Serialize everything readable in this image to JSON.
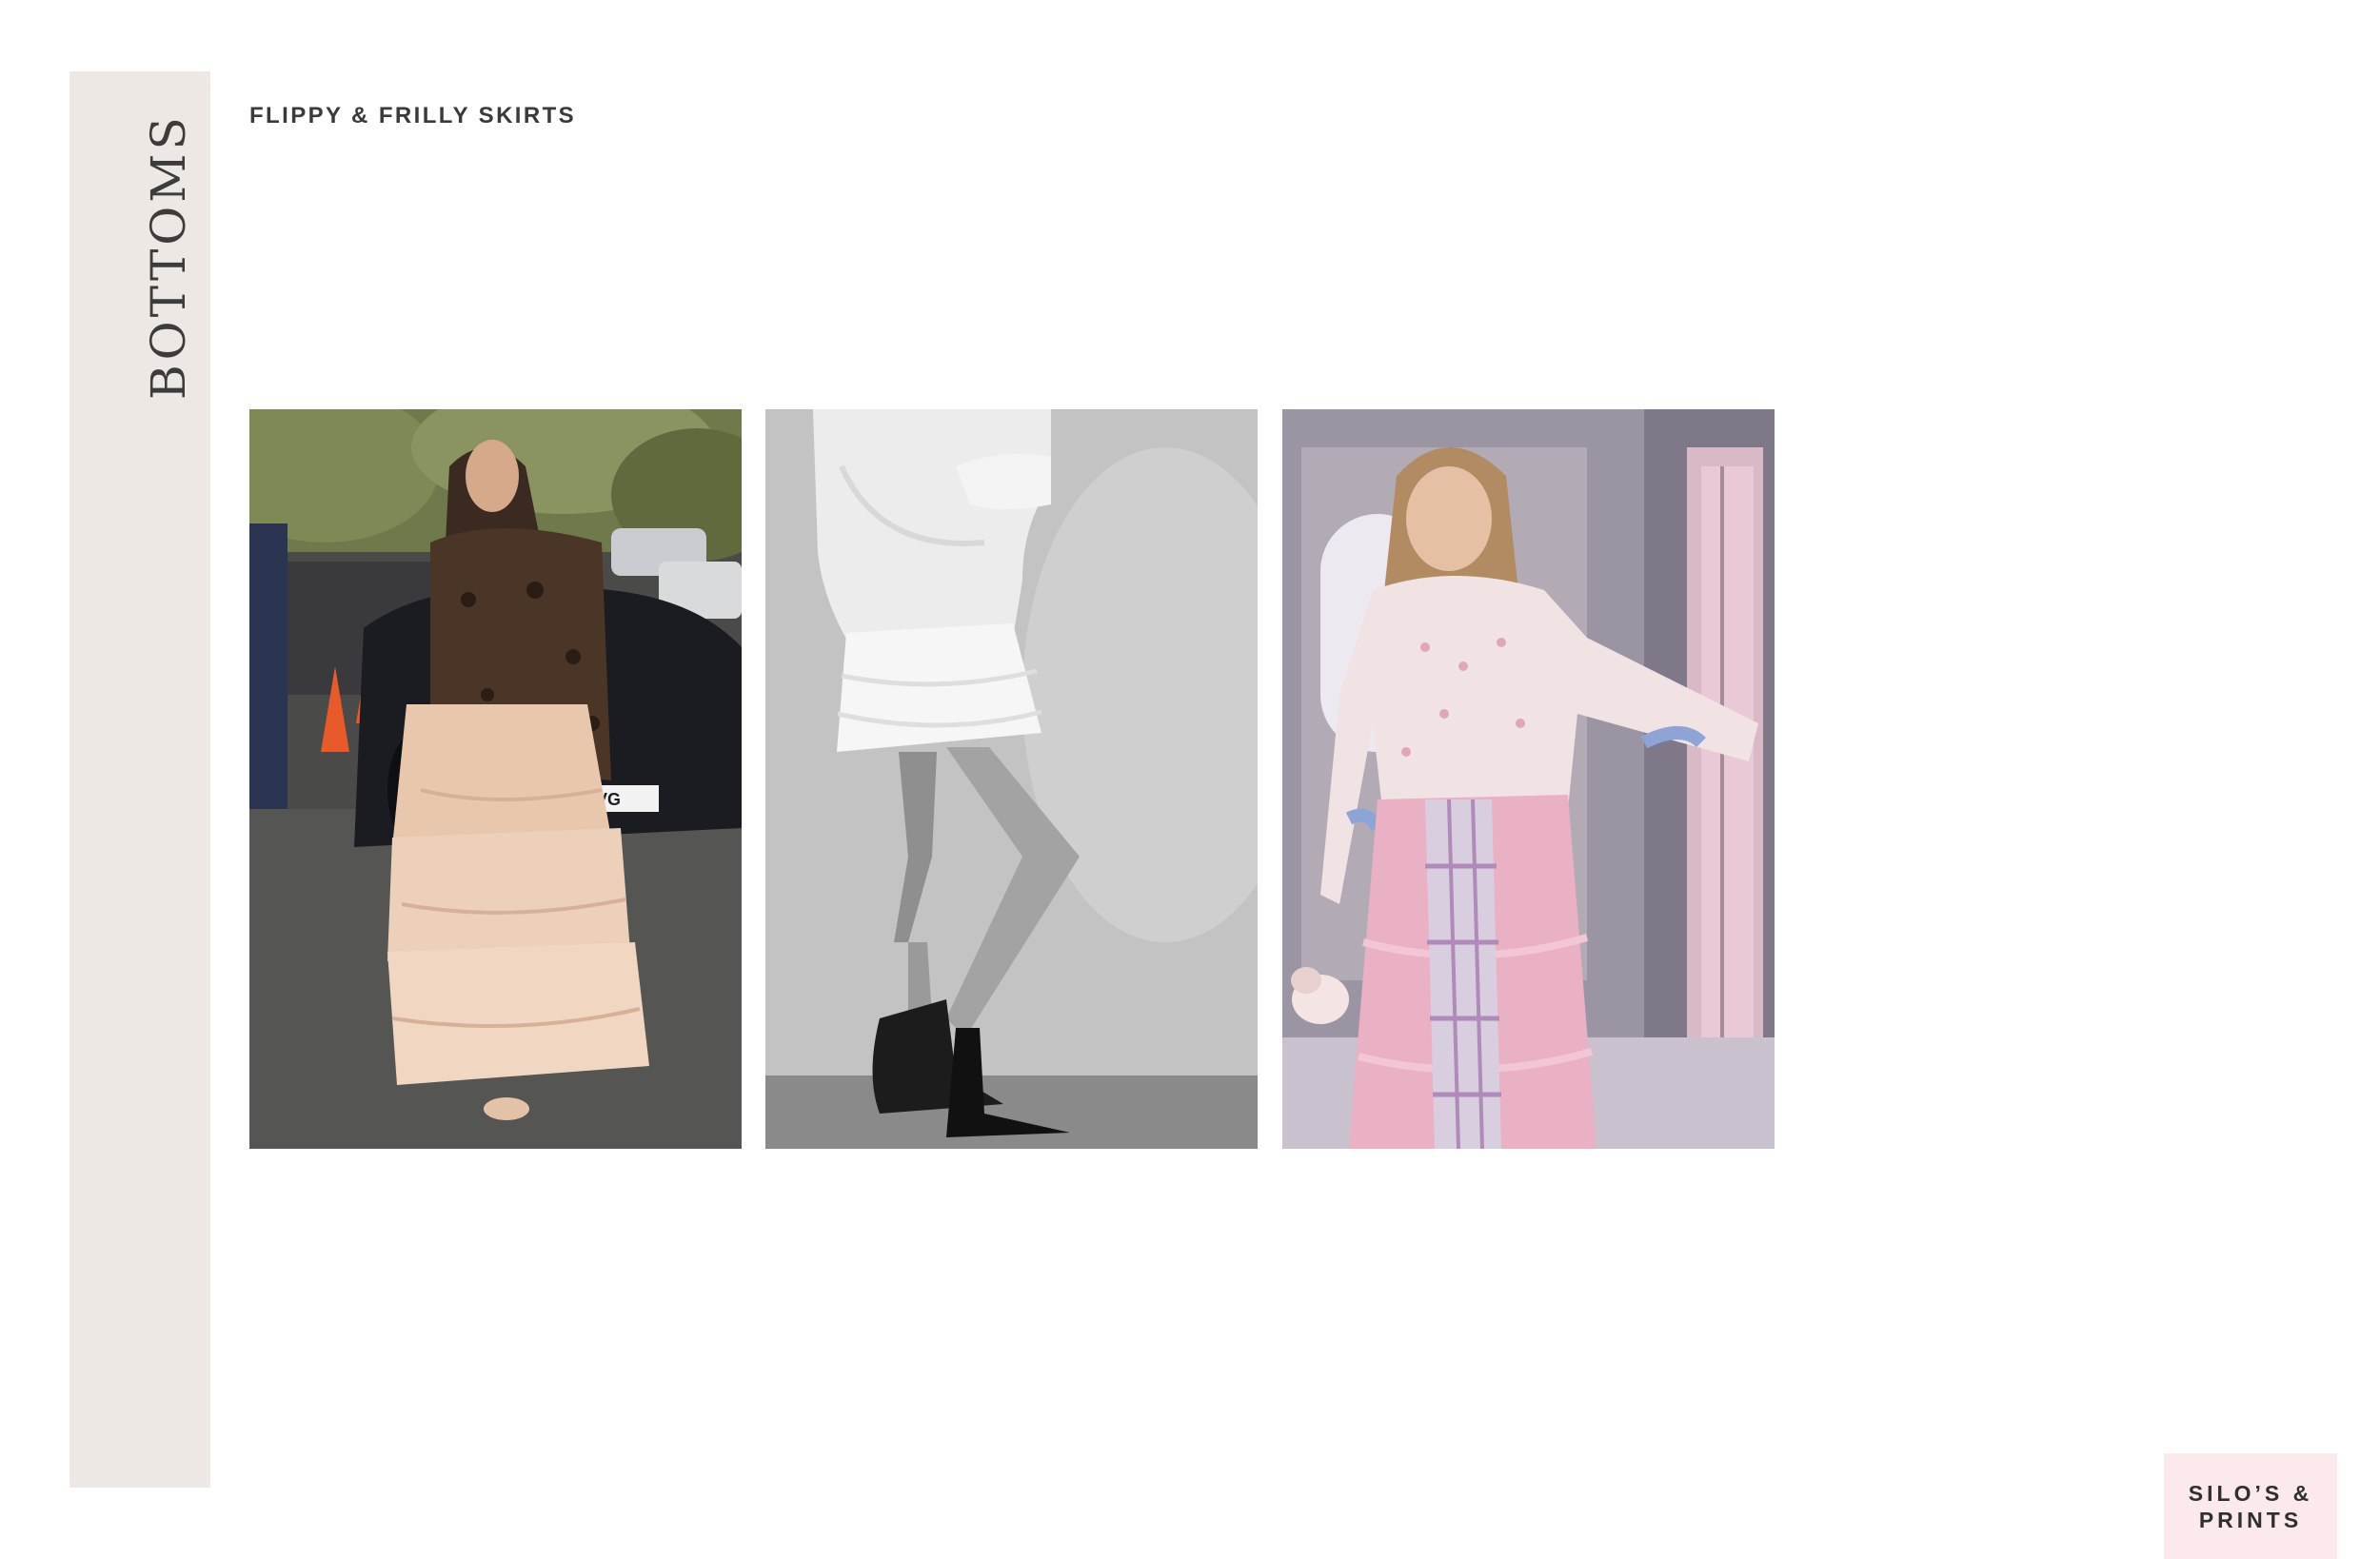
{
  "sidebar": {
    "label": "BOTTOMS"
  },
  "section": {
    "title": "FLIPPY & FRILLY SKIRTS"
  },
  "photos": [
    {
      "kind": "street-style-photo",
      "license_plate_text": "14-VG"
    },
    {
      "kind": "black-and-white-photo"
    },
    {
      "kind": "pink-skirt-photo"
    }
  ],
  "brand": {
    "line1": "SILO’S &",
    "line2": "PRINTS"
  },
  "colors": {
    "sidebar_bg": "#ede8e3",
    "badge_bg": "#fbe9ec",
    "text": "#3a3a3a"
  }
}
